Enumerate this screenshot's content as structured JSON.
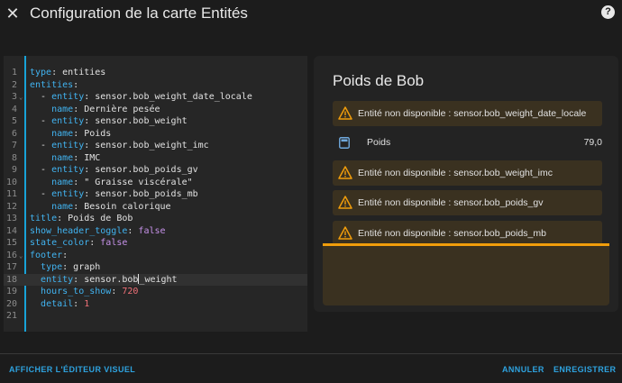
{
  "header": {
    "title": "Configuration de la carte Entités",
    "help_glyph": "?"
  },
  "editor": {
    "lines": [
      [
        {
          "t": "k",
          "v": "type"
        },
        {
          "t": "s",
          "v": ": entities"
        }
      ],
      [
        {
          "t": "k",
          "v": "entities"
        },
        {
          "t": "s",
          "v": ":"
        }
      ],
      [
        {
          "t": "s",
          "v": "  - "
        },
        {
          "t": "k",
          "v": "entity"
        },
        {
          "t": "s",
          "v": ": sensor.bob_weight_date_locale"
        }
      ],
      [
        {
          "t": "s",
          "v": "    "
        },
        {
          "t": "k",
          "v": "name"
        },
        {
          "t": "s",
          "v": ": Dernière pesée"
        }
      ],
      [
        {
          "t": "s",
          "v": "  - "
        },
        {
          "t": "k",
          "v": "entity"
        },
        {
          "t": "s",
          "v": ": sensor.bob_weight"
        }
      ],
      [
        {
          "t": "s",
          "v": "    "
        },
        {
          "t": "k",
          "v": "name"
        },
        {
          "t": "s",
          "v": ": Poids"
        }
      ],
      [
        {
          "t": "s",
          "v": "  - "
        },
        {
          "t": "k",
          "v": "entity"
        },
        {
          "t": "s",
          "v": ": sensor.bob_weight_imc"
        }
      ],
      [
        {
          "t": "s",
          "v": "    "
        },
        {
          "t": "k",
          "v": "name"
        },
        {
          "t": "s",
          "v": ": IMC"
        }
      ],
      [
        {
          "t": "s",
          "v": "  - "
        },
        {
          "t": "k",
          "v": "entity"
        },
        {
          "t": "s",
          "v": ": sensor.bob_poids_gv"
        }
      ],
      [
        {
          "t": "s",
          "v": "    "
        },
        {
          "t": "k",
          "v": "name"
        },
        {
          "t": "s",
          "v": ": \" Graisse viscérale\""
        }
      ],
      [
        {
          "t": "s",
          "v": "  - "
        },
        {
          "t": "k",
          "v": "entity"
        },
        {
          "t": "s",
          "v": ": sensor.bob_poids_mb"
        }
      ],
      [
        {
          "t": "s",
          "v": "    "
        },
        {
          "t": "k",
          "v": "name"
        },
        {
          "t": "s",
          "v": ": Besoin calorique"
        }
      ],
      [
        {
          "t": "k",
          "v": "title"
        },
        {
          "t": "s",
          "v": ": Poids de Bob"
        }
      ],
      [
        {
          "t": "k",
          "v": "show_header_toggle"
        },
        {
          "t": "s",
          "v": ": "
        },
        {
          "t": "b",
          "v": "false"
        }
      ],
      [
        {
          "t": "k",
          "v": "state_color"
        },
        {
          "t": "s",
          "v": ": "
        },
        {
          "t": "b",
          "v": "false"
        }
      ],
      [
        {
          "t": "k",
          "v": "footer"
        },
        {
          "t": "s",
          "v": ":"
        }
      ],
      [
        {
          "t": "s",
          "v": "  "
        },
        {
          "t": "k",
          "v": "type"
        },
        {
          "t": "s",
          "v": ": graph"
        }
      ],
      [
        {
          "t": "s",
          "v": "  "
        },
        {
          "t": "k",
          "v": "entity"
        },
        {
          "t": "s",
          "v": ": sensor.bob"
        },
        {
          "t": "cursor",
          "v": ""
        },
        {
          "t": "s",
          "v": "_weight"
        }
      ],
      [
        {
          "t": "s",
          "v": "  "
        },
        {
          "t": "k",
          "v": "hours_to_show"
        },
        {
          "t": "s",
          "v": ": "
        },
        {
          "t": "n",
          "v": "720"
        }
      ],
      [
        {
          "t": "s",
          "v": "  "
        },
        {
          "t": "k",
          "v": "detail"
        },
        {
          "t": "s",
          "v": ": "
        },
        {
          "t": "n",
          "v": "1"
        }
      ],
      []
    ],
    "fold_lines": [
      3,
      16
    ]
  },
  "card": {
    "title": "Poids de Bob",
    "warnings": [
      "Entité non disponible : sensor.bob_weight_date_locale",
      "Entité non disponible : sensor.bob_weight_imc",
      "Entité non disponible : sensor.bob_poids_gv",
      "Entité non disponible : sensor.bob_poids_mb"
    ],
    "entity": {
      "name": "Poids",
      "value": "79,0",
      "icon": "scale-icon"
    },
    "colors": {
      "warning_accent": "#f09d0b",
      "warning_bg": "#3a3120"
    }
  },
  "footer": {
    "visual_editor_label": "AFFICHER L'ÉDITEUR VISUEL",
    "cancel_label": "ANNULER",
    "save_label": "ENREGISTRER"
  }
}
